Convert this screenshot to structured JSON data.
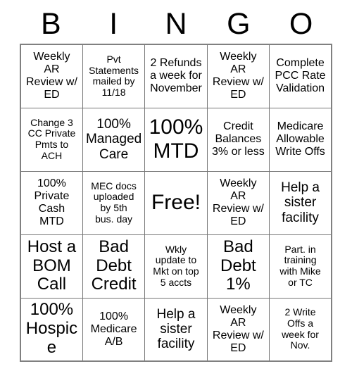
{
  "card": {
    "title": "BINGO",
    "free_space_label": "Free!",
    "header_letters": [
      "B",
      "I",
      "N",
      "G",
      "O"
    ],
    "columns": 5,
    "rows": 5,
    "colors": {
      "background": "#ffffff",
      "text": "#000000",
      "grid_line": "#777777",
      "grid_outer": "#808080"
    },
    "squares": [
      [
        {
          "text": "Weekly\nAR\nReview w/\nED",
          "size": "m"
        },
        {
          "text": "Pvt\nStatements\nmailed by\n11/18",
          "size": "s"
        },
        {
          "text": "2 Refunds\na week for\nNovember",
          "size": "m"
        },
        {
          "text": "Weekly\nAR\nReview w/\nED",
          "size": "m"
        },
        {
          "text": "Complete\nPCC Rate\nValidation",
          "size": "m"
        }
      ],
      [
        {
          "text": "Change 3\nCC Private\nPmts to\nACH",
          "size": "s"
        },
        {
          "text": "100%\nManaged\nCare",
          "size": "l"
        },
        {
          "text": "100%\nMTD",
          "size": "xxl"
        },
        {
          "text": "Credit\nBalances\n3% or less",
          "size": "m"
        },
        {
          "text": "Medicare\nAllowable\nWrite Offs",
          "size": "m"
        }
      ],
      [
        {
          "text": "100%\nPrivate\nCash\nMTD",
          "size": "m"
        },
        {
          "text": "MEC docs\nuploaded\nby 5th\nbus. day",
          "size": "s"
        },
        {
          "text": "Free!",
          "size": "xxl"
        },
        {
          "text": "Weekly\nAR\nReview w/\nED",
          "size": "m"
        },
        {
          "text": "Help a\nsister\nfacility",
          "size": "l"
        }
      ],
      [
        {
          "text": "Host a\nBOM\nCall",
          "size": "xl"
        },
        {
          "text": "Bad\nDebt\nCredit",
          "size": "xl"
        },
        {
          "text": "Wkly\nupdate to\nMkt on top\n5 accts",
          "size": "s"
        },
        {
          "text": "Bad\nDebt\n1%",
          "size": "xl"
        },
        {
          "text": "Part. in\ntraining\nwith Mike\nor TC",
          "size": "s"
        }
      ],
      [
        {
          "text": "100%\nHospice",
          "size": "xl"
        },
        {
          "text": "100%\nMedicare\nA/B",
          "size": "m"
        },
        {
          "text": "Help a\nsister\nfacility",
          "size": "l"
        },
        {
          "text": "Weekly\nAR\nReview w/\nED",
          "size": "m"
        },
        {
          "text": "2 Write\nOffs a\nweek for\nNov.",
          "size": "s"
        }
      ]
    ]
  }
}
